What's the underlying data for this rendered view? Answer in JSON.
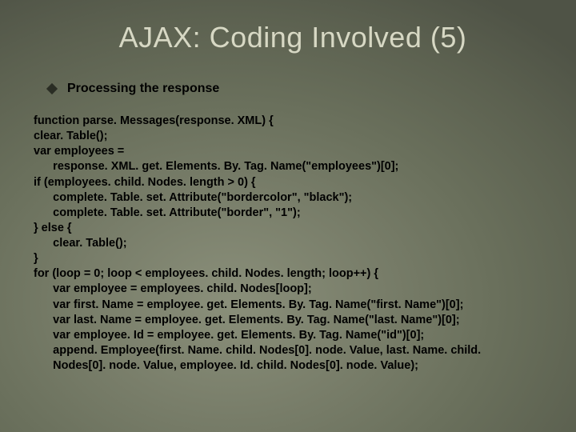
{
  "slide": {
    "title": "AJAX: Coding Involved (5)",
    "bullet": "Processing the response",
    "code": "function parse. Messages(response. XML) {\nclear. Table();\nvar employees =\n      response. XML. get. Elements. By. Tag. Name(\"employees\")[0];\nif (employees. child. Nodes. length > 0) {\n      complete. Table. set. Attribute(\"bordercolor\", \"black\");\n      complete. Table. set. Attribute(\"border\", \"1\");\n} else {\n      clear. Table();\n}\nfor (loop = 0; loop < employees. child. Nodes. length; loop++) {\n      var employee = employees. child. Nodes[loop];\n      var first. Name = employee. get. Elements. By. Tag. Name(\"first. Name\")[0];\n      var last. Name = employee. get. Elements. By. Tag. Name(\"last. Name\")[0];\n      var employee. Id = employee. get. Elements. By. Tag. Name(\"id\")[0];\n      append. Employee(first. Name. child. Nodes[0]. node. Value, last. Name. child.\n      Nodes[0]. node. Value, employee. Id. child. Nodes[0]. node. Value);"
  }
}
